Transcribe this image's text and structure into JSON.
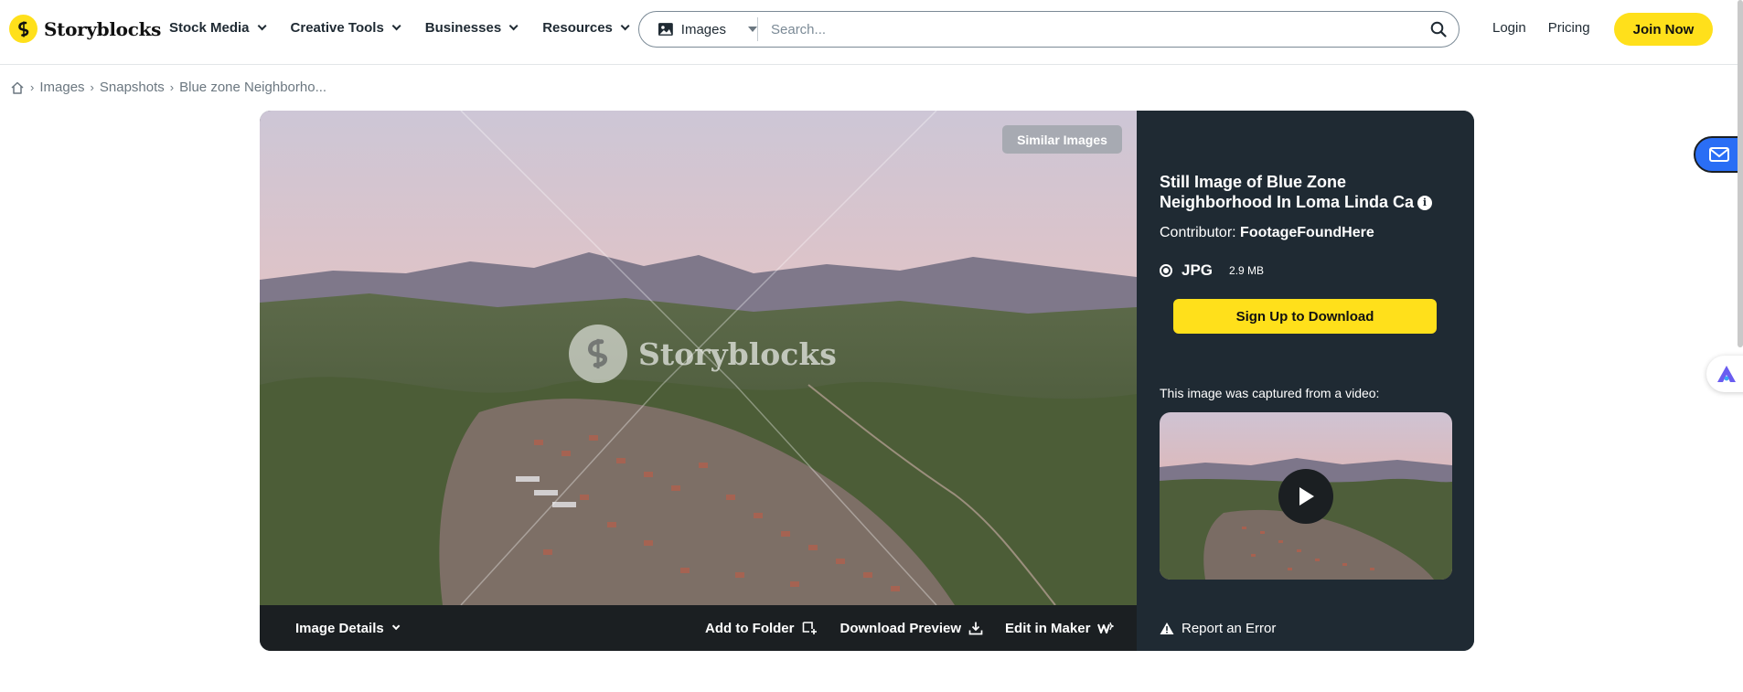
{
  "brand": {
    "name": "Storyblocks",
    "accent": "#ffe01b"
  },
  "nav": {
    "items": [
      {
        "label": "Stock Media"
      },
      {
        "label": "Creative Tools"
      },
      {
        "label": "Businesses"
      },
      {
        "label": "Resources"
      }
    ]
  },
  "search": {
    "type_label": "Images",
    "placeholder": "Search..."
  },
  "header": {
    "login": "Login",
    "pricing": "Pricing",
    "join": "Join Now"
  },
  "breadcrumb": {
    "items": [
      "Images",
      "Snapshots",
      "Blue zone Neighborho..."
    ]
  },
  "photo": {
    "similar_label": "Similar Images",
    "watermark_text": "Storyblocks",
    "details_label": "Image Details",
    "actions": {
      "add_folder": "Add to Folder",
      "download_preview": "Download Preview",
      "edit_maker": "Edit in Maker"
    }
  },
  "sidebar": {
    "title": "Still Image of Blue Zone Neighborhood In Loma Linda Ca",
    "contributor_prefix": "Contributor:",
    "contributor_name": "FootageFoundHere",
    "format": {
      "name": "JPG",
      "size": "2.9 MB",
      "selected": true
    },
    "signup_label": "Sign Up to Download",
    "captured_text": "This image was captured from a video:",
    "report_label": "Report an Error"
  },
  "colors": {
    "panel": "#1f2a33",
    "bar": "#1b1f22",
    "button": "#ffe01b"
  }
}
